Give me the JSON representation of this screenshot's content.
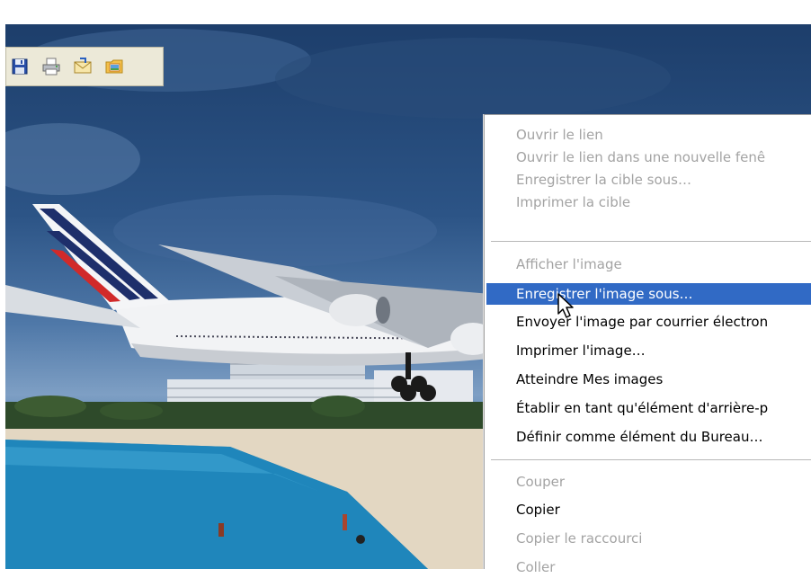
{
  "colors": {
    "menu_highlight": "#316ac5",
    "menu_disabled_text": "#a3a3a3",
    "toolbar_bg": "#ece9d8"
  },
  "image_toolbar": {
    "buttons": [
      {
        "name": "save",
        "icon": "floppy-disk-icon"
      },
      {
        "name": "print",
        "icon": "printer-icon"
      },
      {
        "name": "email",
        "icon": "envelope-icon"
      },
      {
        "name": "my-pictures",
        "icon": "folder-pictures-icon"
      }
    ]
  },
  "context_menu": {
    "items": [
      {
        "label": "Ouvrir le lien",
        "disabled": true
      },
      {
        "label": "Ouvrir le lien dans une nouvelle fenê",
        "disabled": true
      },
      {
        "label": "Enregistrer la cible sous…",
        "disabled": true
      },
      {
        "label": "Imprimer la cible",
        "disabled": true
      },
      {
        "label": "Afficher l'image",
        "disabled": true
      },
      {
        "label": "Enregistrer l'image sous…",
        "disabled": false,
        "highlighted": true
      },
      {
        "label": "Envoyer l'image par courrier électron",
        "disabled": false
      },
      {
        "label": "Imprimer l'image…",
        "disabled": false
      },
      {
        "label": "Atteindre Mes images",
        "disabled": false
      },
      {
        "label": "Établir en tant qu'élément d'arrière-p",
        "disabled": false
      },
      {
        "label": "Définir comme élément du Bureau…",
        "disabled": false
      },
      {
        "label": "Couper",
        "disabled": true
      },
      {
        "label": "Copier",
        "disabled": false
      },
      {
        "label": "Copier le raccourci",
        "disabled": true
      },
      {
        "label": "Coller",
        "disabled": true
      }
    ]
  }
}
